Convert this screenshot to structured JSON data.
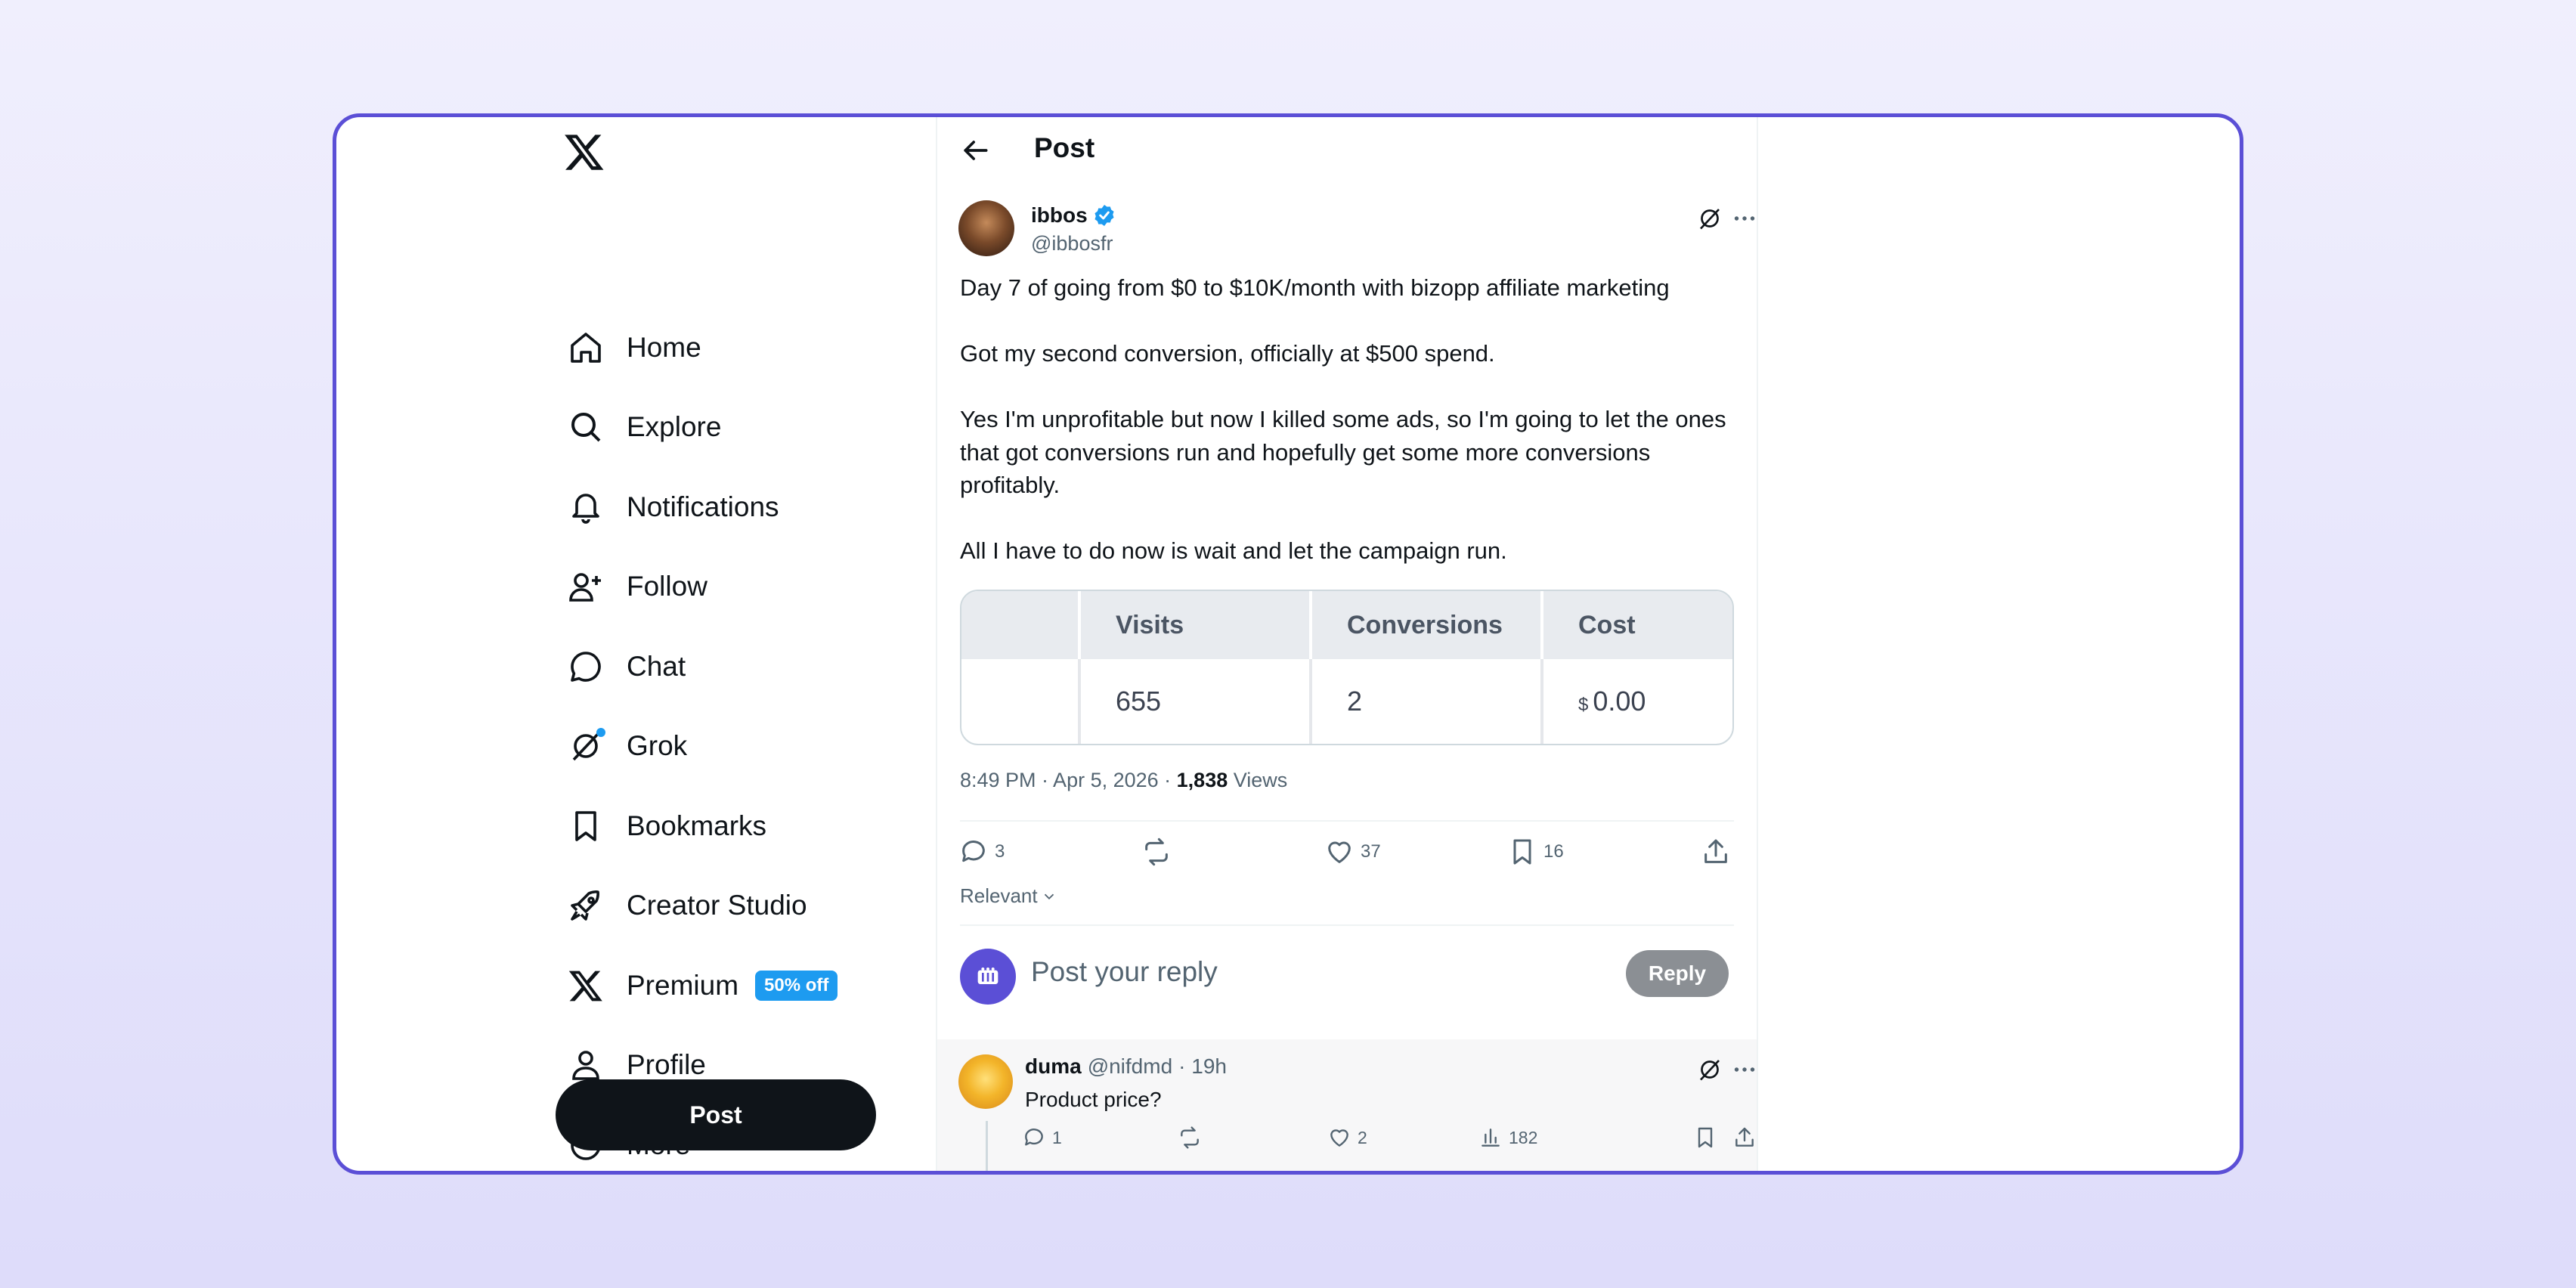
{
  "sidebar": {
    "logo": "x-logo-icon",
    "items": [
      {
        "label": "Home",
        "icon": "home-icon"
      },
      {
        "label": "Explore",
        "icon": "search-icon"
      },
      {
        "label": "Notifications",
        "icon": "bell-icon"
      },
      {
        "label": "Follow",
        "icon": "add-user-icon"
      },
      {
        "label": "Chat",
        "icon": "chat-bubble-icon"
      },
      {
        "label": "Grok",
        "icon": "grok-icon"
      },
      {
        "label": "Bookmarks",
        "icon": "bookmark-icon"
      },
      {
        "label": "Creator Studio",
        "icon": "rocket-icon"
      },
      {
        "label": "Premium",
        "icon": "x-logo-icon",
        "badge": "50% off"
      },
      {
        "label": "Profile",
        "icon": "person-icon"
      },
      {
        "label": "More",
        "icon": "more-circle-icon"
      }
    ],
    "post_button": "Post"
  },
  "header": {
    "title": "Post"
  },
  "post": {
    "author_name": "ibbos",
    "author_handle": "@ibbosfr",
    "paragraphs": [
      "Day 7 of going from $0 to $10K/month with bizopp affiliate marketing",
      "Got my second conversion, officially at $500 spend.",
      "Yes I'm unprofitable but now I killed some ads, so I'm going to let the ones that got conversions run and hopefully get some more conversions profitably.",
      "All I have to do now is wait and let the campaign run."
    ],
    "table": {
      "headers": [
        "",
        "Visits",
        "Conversions",
        "Cost"
      ],
      "row": [
        "",
        "655",
        "2",
        "0.00"
      ],
      "currency": "$"
    },
    "timestamp": "8:49 PM · Apr 5, 2026 · ",
    "views_count": "1,838",
    "views_label": " Views",
    "actions": {
      "replies": "3",
      "likes": "37",
      "bookmarks": "16"
    }
  },
  "sort_label": "Relevant",
  "reply_box": {
    "placeholder": "Post your reply",
    "button": "Reply"
  },
  "comment": {
    "name": "duma",
    "handle": "@nifdmd",
    "time": "· 19h",
    "text": "Product price?",
    "replies": "1",
    "likes": "2",
    "views": "182"
  },
  "colors": {
    "accent": "#1d9bf0",
    "frame": "#5b4fd6",
    "text": "#0f1419",
    "muted": "#536471"
  }
}
